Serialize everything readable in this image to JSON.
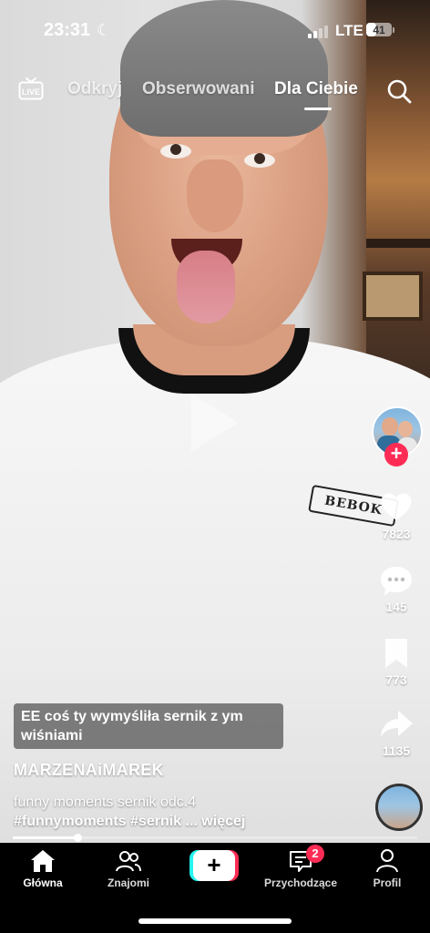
{
  "status_bar": {
    "time": "23:31",
    "network": "LTE",
    "battery_level": "41",
    "battery_fraction": 0.41
  },
  "top_nav": {
    "live_label": "LIVE",
    "tabs": [
      {
        "label": "Odkryj",
        "active": false
      },
      {
        "label": "Obserwowani",
        "active": false
      },
      {
        "label": "Dla Ciebie",
        "active": true
      }
    ]
  },
  "video": {
    "shirt_patch_text": "BEBOK"
  },
  "actions": {
    "likes": "7823",
    "comments": "145",
    "saves": "773",
    "shares": "1135"
  },
  "post": {
    "caption_overlay": "EE coś ty wymyśliła sernik z ym wiśniami",
    "username": "MARZENAiMAREK",
    "description_line1": "funny moments sernik odc.4",
    "description_line2": "#funnymoments #sernik",
    "more_label": "... więcej",
    "progress": 0.16
  },
  "bottom_nav": {
    "items": [
      {
        "label": "Główna",
        "active": true
      },
      {
        "label": "Znajomi",
        "active": false
      },
      {
        "label": "Przychodzące",
        "active": false,
        "badge": "2"
      },
      {
        "label": "Profil",
        "active": false
      }
    ]
  },
  "colors": {
    "accent_red": "#fe2c55",
    "accent_cyan": "#25f4ee",
    "nav_background": "#000000"
  }
}
